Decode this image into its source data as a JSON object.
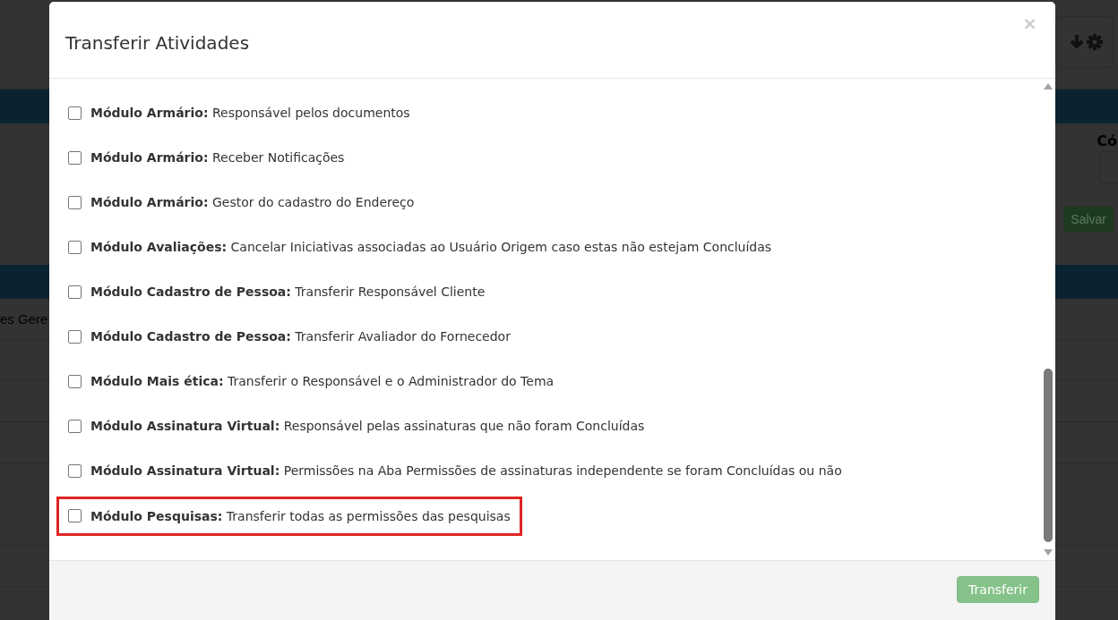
{
  "background": {
    "field_label": "Có",
    "save_button": "Salvar",
    "table_rows": [
      "es Gere",
      "",
      "",
      "",
      "",
      "",
      ""
    ]
  },
  "dialog": {
    "title": "Transferir Atividades",
    "close": "×",
    "options": [
      {
        "label": "**Módulo Armário:** Responsável pelos documentos",
        "checked": false,
        "highlighted": false
      },
      {
        "label": "**Módulo Armário:** Receber Notificações",
        "checked": false,
        "highlighted": false
      },
      {
        "label": "**Módulo Armário:** Gestor do cadastro do Endereço",
        "checked": false,
        "highlighted": false
      },
      {
        "label": "**Módulo Avaliações:** Cancelar Iniciativas associadas ao Usuário Origem caso estas não estejam Concluídas",
        "checked": false,
        "highlighted": false
      },
      {
        "label": "**Módulo Cadastro de Pessoa:** Transferir Responsável Cliente",
        "checked": false,
        "highlighted": false
      },
      {
        "label": "**Módulo Cadastro de Pessoa:** Transferir Avaliador do Fornecedor",
        "checked": false,
        "highlighted": false
      },
      {
        "label": "**Módulo Mais ética:** Transferir o Responsável e o Administrador do Tema",
        "checked": false,
        "highlighted": false
      },
      {
        "label": "**Módulo Assinatura Virtual:** Responsável pelas assinaturas que não foram Concluídas",
        "checked": false,
        "highlighted": false
      },
      {
        "label": "**Módulo Assinatura Virtual:** Permissões na Aba Permissões de assinaturas independente se foram Concluídas ou não",
        "checked": false,
        "highlighted": false
      },
      {
        "label": "**Módulo Pesquisas:** Transferir todas as permissões das pesquisas",
        "checked": false,
        "highlighted": true
      }
    ],
    "submit": {
      "label": "Transferir",
      "disabled": true
    }
  }
}
